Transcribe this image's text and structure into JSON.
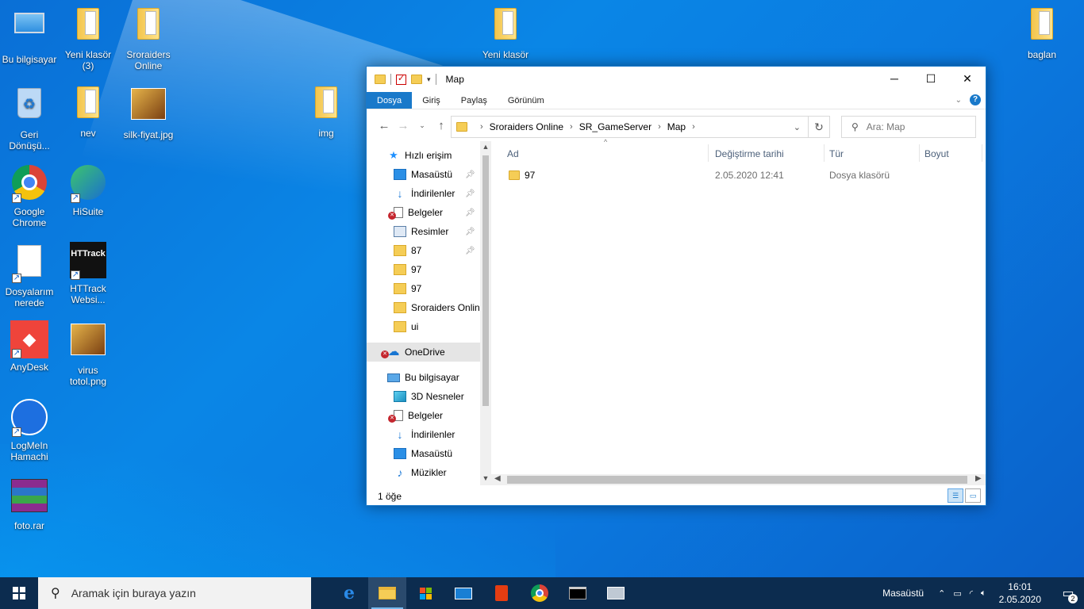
{
  "desktop": {
    "icons": [
      {
        "label": "Bu bilgisayar",
        "icon": "computer-icon"
      },
      {
        "label": "Yeni klasör (3)",
        "icon": "folder-icon"
      },
      {
        "label": "Sroraiders Online",
        "icon": "folder-icon"
      },
      {
        "label": "Yeni klasör",
        "icon": "folder-icon"
      },
      {
        "label": "baglan",
        "icon": "folder-icon"
      },
      {
        "label": "Geri Dönüşü...",
        "icon": "recycle-bin-icon"
      },
      {
        "label": "nev",
        "icon": "folder-icon"
      },
      {
        "label": "silk-fiyat.jpg",
        "icon": "image-file-icon"
      },
      {
        "label": "img",
        "icon": "folder-icon"
      },
      {
        "label": "Google Chrome",
        "icon": "chrome-icon"
      },
      {
        "label": "HiSuite",
        "icon": "hisuite-icon"
      },
      {
        "label": "Dosyalarım nerede",
        "icon": "document-icon"
      },
      {
        "label": "HTTrack Websi...",
        "icon": "httrack-icon"
      },
      {
        "label": "AnyDesk",
        "icon": "anydesk-icon"
      },
      {
        "label": "virus totol.png",
        "icon": "image-file-icon"
      },
      {
        "label": "LogMeIn Hamachi",
        "icon": "hamachi-icon"
      },
      {
        "label": "foto.rar",
        "icon": "winrar-icon"
      }
    ]
  },
  "explorer": {
    "title": "Map",
    "ribbon_tabs": [
      "Dosya",
      "Giriş",
      "Paylaş",
      "Görünüm"
    ],
    "address": [
      "Sroraiders Online",
      "SR_GameServer",
      "Map"
    ],
    "search_placeholder": "Ara: Map",
    "nav": [
      {
        "label": "Hızlı erişim",
        "icon": "star-icon",
        "indent": 0
      },
      {
        "label": "Masaüstü",
        "icon": "desktop-icon",
        "indent": 1,
        "pinned": true
      },
      {
        "label": "İndirilenler",
        "icon": "download-icon",
        "indent": 1,
        "pinned": true
      },
      {
        "label": "Belgeler",
        "icon": "documents-icon",
        "indent": 1,
        "pinned": true,
        "error": true
      },
      {
        "label": "Resimler",
        "icon": "pictures-icon",
        "indent": 1,
        "pinned": true
      },
      {
        "label": "87",
        "icon": "folder-icon",
        "indent": 1,
        "pinned": true
      },
      {
        "label": "97",
        "icon": "folder-icon",
        "indent": 1
      },
      {
        "label": "97",
        "icon": "folder-icon",
        "indent": 1
      },
      {
        "label": "Sroraiders Online",
        "icon": "folder-icon",
        "indent": 1
      },
      {
        "label": "ui",
        "icon": "folder-icon",
        "indent": 1
      },
      {
        "label": "OneDrive",
        "icon": "cloud-icon",
        "indent": 0,
        "error": true,
        "selected": true
      },
      {
        "label": "Bu bilgisayar",
        "icon": "pc-icon",
        "indent": 0
      },
      {
        "label": "3D Nesneler",
        "icon": "objects-3d-icon",
        "indent": 1
      },
      {
        "label": "Belgeler",
        "icon": "documents-icon",
        "indent": 1,
        "error": true
      },
      {
        "label": "İndirilenler",
        "icon": "download-icon",
        "indent": 1
      },
      {
        "label": "Masaüstü",
        "icon": "desktop-icon",
        "indent": 1
      },
      {
        "label": "Müzikler",
        "icon": "music-icon",
        "indent": 1
      }
    ],
    "columns": [
      "Ad",
      "Değiştirme tarihi",
      "Tür",
      "Boyut"
    ],
    "files": [
      {
        "name": "97",
        "modified": "2.05.2020 12:41",
        "type": "Dosya klasörü",
        "size": ""
      }
    ],
    "status": "1 öğe"
  },
  "taskbar": {
    "search_placeholder": "Aramak için buraya yazın",
    "apps": [
      "edge-icon",
      "file-explorer-icon",
      "store-icon",
      "mail-icon",
      "office-icon",
      "chrome-icon",
      "terminal-icon",
      "pc-monitor-icon"
    ],
    "tray_label": "Masaüstü",
    "time": "16:01",
    "date": "2.05.2020",
    "notifications": "2"
  }
}
